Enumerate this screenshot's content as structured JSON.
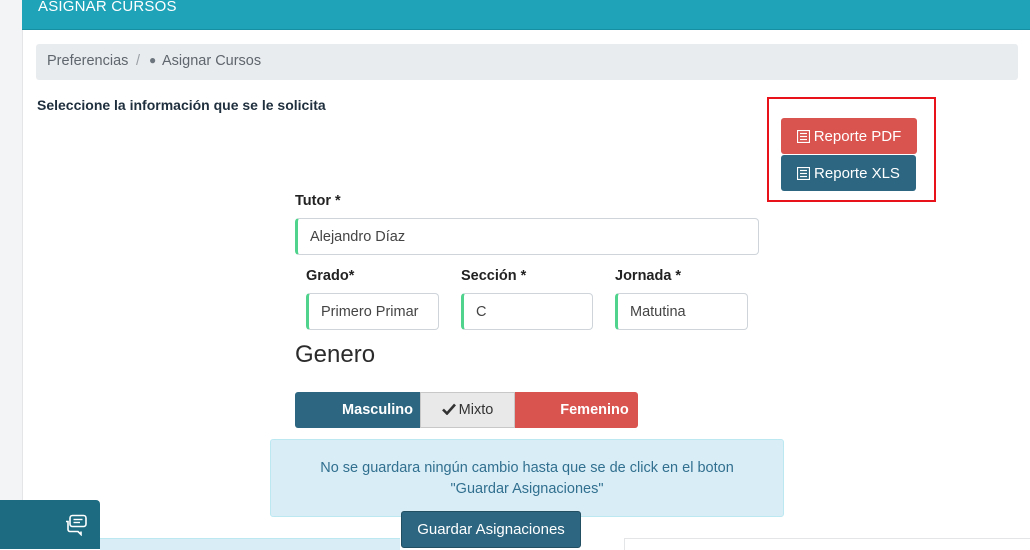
{
  "header": {
    "title": "ASIGNAR CURSOS"
  },
  "breadcrumb": {
    "items": [
      "Preferencias",
      "Asignar Cursos"
    ],
    "separator": "/",
    "dot": "●"
  },
  "instruction": "Seleccione la información que se le solicita",
  "reports": {
    "pdf_label": "Reporte PDF",
    "xls_label": "Reporte XLS",
    "pdf_color": "#d9534f",
    "xls_color": "#2c6680",
    "highlight_color": "#e8121a"
  },
  "form": {
    "tutor_label": "Tutor *",
    "tutor_value": "Alejandro Díaz",
    "grado_label": "Grado*",
    "grado_value": "Primero Primar",
    "seccion_label": "Sección *",
    "seccion_value": "C",
    "jornada_label": "Jornada *",
    "jornada_value": "Matutina"
  },
  "genero": {
    "title": "Genero",
    "options": [
      "Masculino",
      "Mixto",
      "Femenino"
    ],
    "selected": "Mixto"
  },
  "alert": {
    "line1": "No se guardara ningún cambio hasta que se de click en el boton",
    "line2": "\"Guardar Asignaciones\""
  },
  "save_button": "Guardar Asignaciones",
  "colors": {
    "header": "#1ea3b9",
    "accent_field": "#4fd38d",
    "primary": "#2c6680",
    "danger": "#d9534f"
  }
}
